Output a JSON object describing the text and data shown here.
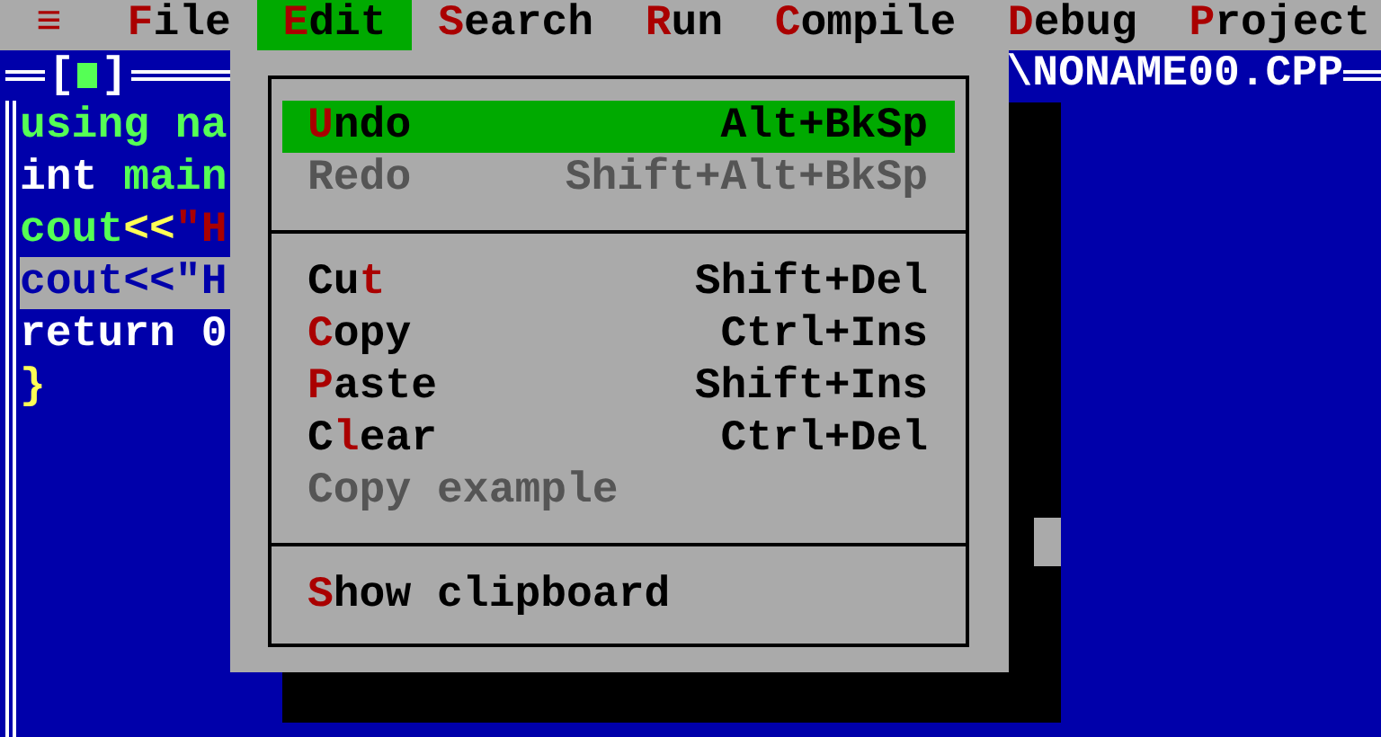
{
  "menu_bar": {
    "system_menu": "≡",
    "items": [
      {
        "key": "F",
        "post": "ile",
        "selected": false
      },
      {
        "key": "E",
        "post": "dit",
        "selected": true
      },
      {
        "key": "S",
        "post": "earch",
        "selected": false
      },
      {
        "key": "R",
        "post": "un",
        "selected": false
      },
      {
        "key": "C",
        "post": "ompile",
        "selected": false
      },
      {
        "key": "D",
        "post": "ebug",
        "selected": false
      },
      {
        "key": "P",
        "post": "roject",
        "selected": false
      }
    ]
  },
  "editor": {
    "close_box": {
      "left": "[",
      "right": "]"
    },
    "title": "\\NONAME00.CPP",
    "lines": [
      {
        "selected": false,
        "tokens": [
          {
            "text": "using na",
            "color": "#55ff55"
          }
        ]
      },
      {
        "selected": false,
        "tokens": [
          {
            "text": "int ",
            "color": "#ffffff"
          },
          {
            "text": "main",
            "color": "#55ff55"
          }
        ]
      },
      {
        "selected": false,
        "tokens": [
          {
            "text": "cout",
            "color": "#55ff55"
          },
          {
            "text": "<<",
            "color": "#ffff55"
          },
          {
            "text": "\"H",
            "color": "#aa0000"
          }
        ]
      },
      {
        "selected": true,
        "tokens": [
          {
            "text": "cout<<\"H",
            "color": "#0000aa"
          }
        ]
      },
      {
        "selected": false,
        "tokens": [
          {
            "text": "return 0",
            "color": "#ffffff"
          }
        ]
      },
      {
        "selected": false,
        "tokens": [
          {
            "text": "}",
            "color": "#ffff55"
          }
        ]
      }
    ]
  },
  "edit_menu": {
    "items": [
      {
        "kind": "item",
        "key": "U",
        "post": "ndo",
        "shortcut": "Alt+BkSp",
        "selected": true,
        "disabled": false
      },
      {
        "kind": "item",
        "label": "Redo",
        "shortcut": "Shift+Alt+BkSp",
        "selected": false,
        "disabled": true
      },
      {
        "kind": "separator"
      },
      {
        "kind": "item",
        "pre": "Cu",
        "key": "t",
        "shortcut": "Shift+Del",
        "selected": false,
        "disabled": false
      },
      {
        "kind": "item",
        "key": "C",
        "post": "opy",
        "shortcut": "Ctrl+Ins",
        "selected": false,
        "disabled": false
      },
      {
        "kind": "item",
        "key": "P",
        "post": "aste",
        "shortcut": "Shift+Ins",
        "selected": false,
        "disabled": false
      },
      {
        "kind": "item",
        "pre": "C",
        "key": "l",
        "post": "ear",
        "shortcut": "Ctrl+Del",
        "selected": false,
        "disabled": false
      },
      {
        "kind": "item",
        "label": "Copy example",
        "selected": false,
        "disabled": true
      },
      {
        "kind": "separator"
      },
      {
        "kind": "item",
        "key": "S",
        "post": "how clipboard",
        "selected": false,
        "disabled": false
      }
    ]
  }
}
